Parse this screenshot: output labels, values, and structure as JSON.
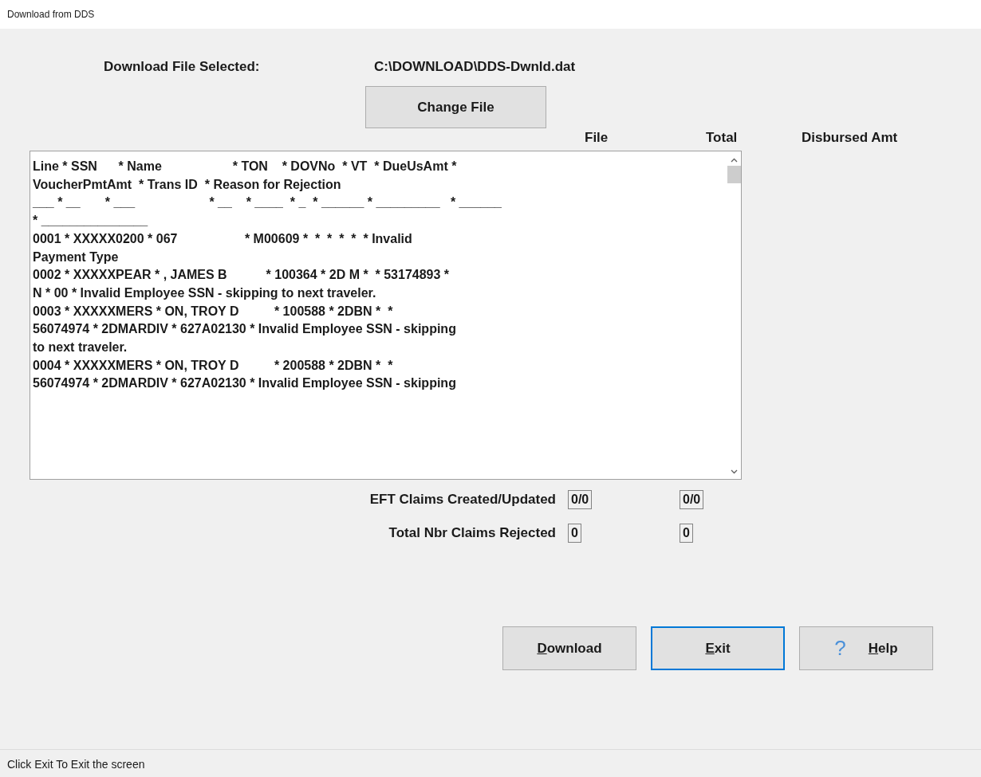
{
  "window": {
    "title": "Download from DDS"
  },
  "file": {
    "label": "Download File Selected:",
    "path": "C:\\DOWNLOAD\\DDS-Dwnld.dat"
  },
  "change_file_button": "Change File",
  "columns": [
    "File",
    "Total",
    "Disbursed Amt"
  ],
  "log_lines": [
    "Line * SSN      * Name                    * TON    * DOVNo  * VT  * DueUsAmt *",
    "VoucherPmtAmt  * Trans ID  * Reason for Rejection",
    "___ * __       * ___                     * __    * ____  * _  * ______ * _________   * ______",
    "* _______________",
    "0001 * XXXXX0200 * 067                   * M00609 *  *  *  *  *  * Invalid",
    "Payment Type",
    "0002 * XXXXXPEAR * , JAMES B           * 100364 * 2D M *  * 53174893 *",
    "N * 00 * Invalid Employee SSN - skipping to next traveler.",
    "0003 * XXXXXMERS * ON, TROY D          * 100588 * 2DBN *  *",
    "56074974 * 2DMARDIV * 627A02130 * Invalid Employee SSN - skipping",
    "to next traveler.",
    "0004 * XXXXXMERS * ON, TROY D          * 200588 * 2DBN *  *",
    "56074974 * 2DMARDIV * 627A02130 * Invalid Employee SSN - skipping"
  ],
  "counts": [
    {
      "label": "EFT Claims Created/Updated",
      "file": "0/0",
      "total": "0/0"
    },
    {
      "label": "Total Nbr Claims Rejected",
      "file": "0",
      "total": "0"
    }
  ],
  "buttons": [
    {
      "kind": "plain",
      "mnemonic": "D",
      "rest": "ownload",
      "selected": false
    },
    {
      "kind": "plain",
      "mnemonic": "E",
      "rest": "xit",
      "selected": true
    },
    {
      "kind": "help",
      "icon": "?",
      "mnemonic": "H",
      "rest": "elp",
      "selected": false
    }
  ],
  "status_bar": "Click Exit To Exit the screen"
}
